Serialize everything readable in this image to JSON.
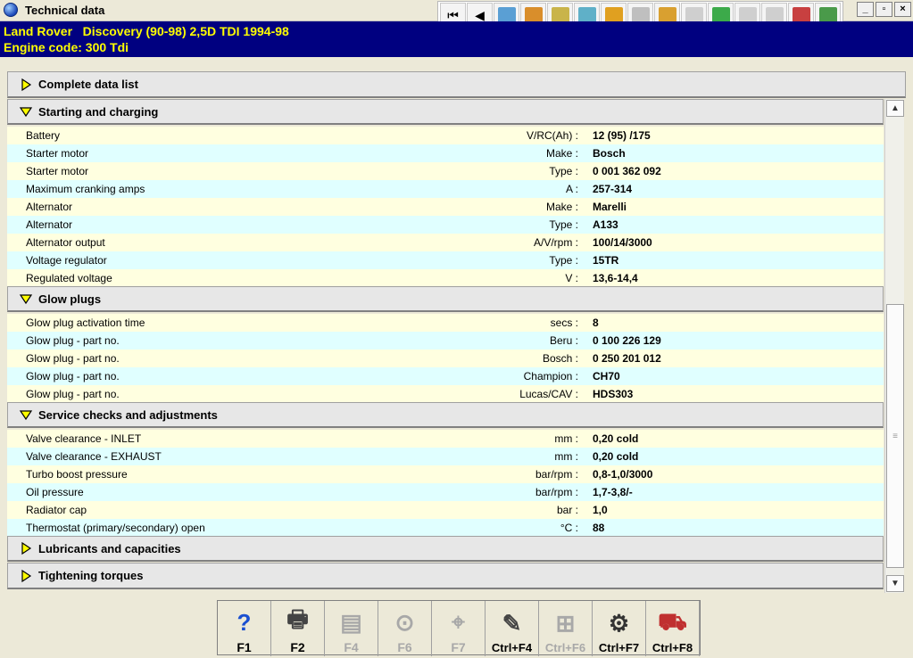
{
  "window": {
    "title": "Technical data",
    "controls": [
      "_",
      "▫",
      "×"
    ]
  },
  "toolbar": {
    "buttons": [
      {
        "name": "first-record-button",
        "glyph": "⏮",
        "color": ""
      },
      {
        "name": "previous-button",
        "glyph": "◀",
        "color": ""
      },
      {
        "name": "map-icon",
        "glyph": "",
        "color": "#5a9fd4"
      },
      {
        "name": "engine-icon",
        "glyph": "",
        "color": "#d98e2b"
      },
      {
        "name": "tools-icon",
        "glyph": "",
        "color": "#c9b44a"
      },
      {
        "name": "diagnostics-icon",
        "glyph": "",
        "color": "#5fb0c8"
      },
      {
        "name": "oil-icon",
        "glyph": "",
        "color": "#e0a020"
      },
      {
        "name": "lift-icon",
        "glyph": "",
        "color": "#bfbfbf"
      },
      {
        "name": "parts-icon",
        "glyph": "",
        "color": "#d9a030"
      },
      {
        "name": "wiring-icon",
        "glyph": "",
        "color": "#cfcfcf"
      },
      {
        "name": "battery-icon",
        "glyph": "",
        "color": "#3caa4a"
      },
      {
        "name": "brake-icon",
        "glyph": "",
        "color": "#cfcfcf"
      },
      {
        "name": "wheel-icon",
        "glyph": "",
        "color": "#cfcfcf"
      },
      {
        "name": "car-service-icon",
        "glyph": "",
        "color": "#c84040"
      },
      {
        "name": "extra-icon",
        "glyph": "",
        "color": "#4a9a4a"
      }
    ]
  },
  "vehicle": {
    "line1": "Land Rover   Discovery (90-98) 2,5D TDI 1994-98",
    "line2": "Engine code: 300 Tdi"
  },
  "sections": {
    "complete": {
      "title": "Complete data list"
    },
    "starting": {
      "title": "Starting and charging",
      "rows": [
        {
          "label": "Battery",
          "unit": "V/RC(Ah) :",
          "value": "12 (95) /175"
        },
        {
          "label": "Starter motor",
          "unit": "Make :",
          "value": "Bosch"
        },
        {
          "label": "Starter motor",
          "unit": "Type :",
          "value": "0 001 362 092"
        },
        {
          "label": "Maximum cranking amps",
          "unit": "A :",
          "value": "257-314"
        },
        {
          "label": "Alternator",
          "unit": "Make :",
          "value": "Marelli"
        },
        {
          "label": "Alternator",
          "unit": "Type :",
          "value": "A133"
        },
        {
          "label": "Alternator output",
          "unit": "A/V/rpm :",
          "value": "100/14/3000"
        },
        {
          "label": "Voltage regulator",
          "unit": "Type :",
          "value": "15TR"
        },
        {
          "label": "Regulated voltage",
          "unit": "V :",
          "value": "13,6-14,4"
        }
      ]
    },
    "glow": {
      "title": "Glow plugs",
      "rows": [
        {
          "label": "Glow plug activation time",
          "unit": "secs :",
          "value": "8"
        },
        {
          "label": "Glow plug - part no.",
          "unit": "Beru :",
          "value": "0 100 226 129"
        },
        {
          "label": "Glow plug - part no.",
          "unit": "Bosch :",
          "value": "0 250 201 012"
        },
        {
          "label": "Glow plug - part no.",
          "unit": "Champion :",
          "value": "CH70"
        },
        {
          "label": "Glow plug - part no.",
          "unit": "Lucas/CAV :",
          "value": "HDS303"
        }
      ]
    },
    "service": {
      "title": "Service checks and adjustments",
      "rows": [
        {
          "label": "Valve clearance - INLET",
          "unit": "mm :",
          "value": "0,20  cold"
        },
        {
          "label": "Valve clearance - EXHAUST",
          "unit": "mm :",
          "value": "0,20  cold"
        },
        {
          "label": "Turbo boost pressure",
          "unit": "bar/rpm :",
          "value": "0,8-1,0/3000"
        },
        {
          "label": "Oil pressure",
          "unit": "bar/rpm :",
          "value": "1,7-3,8/-"
        },
        {
          "label": "Radiator cap",
          "unit": "bar :",
          "value": "1,0"
        },
        {
          "label": "Thermostat (primary/secondary) open",
          "unit": "°C :",
          "value": "88"
        }
      ]
    },
    "lubricants": {
      "title": "Lubricants and capacities"
    },
    "torques": {
      "title": "Tightening torques"
    }
  },
  "scrollbar": {
    "up": "▲",
    "down": "▼",
    "grip": "≡"
  },
  "fkeys": [
    {
      "name": "f1-help-button",
      "label": "F1",
      "glyph": "?",
      "color": "#1a4fd0",
      "disabled": false
    },
    {
      "name": "f2-print-button",
      "label": "F2",
      "glyph": "🖶",
      "color": "#444444",
      "disabled": false
    },
    {
      "name": "f4-button",
      "label": "F4",
      "glyph": "▤",
      "color": "#a8a8a8",
      "disabled": true
    },
    {
      "name": "f6-button",
      "label": "F6",
      "glyph": "⊙",
      "color": "#a8a8a8",
      "disabled": true
    },
    {
      "name": "f7-button",
      "label": "F7",
      "glyph": "⌖",
      "color": "#a8a8a8",
      "disabled": true
    },
    {
      "name": "ctrl-f4-button",
      "label": "Ctrl+F4",
      "glyph": "✎",
      "color": "#444444",
      "disabled": false
    },
    {
      "name": "ctrl-f6-button",
      "label": "Ctrl+F6",
      "glyph": "⊞",
      "color": "#a8a8a8",
      "disabled": true
    },
    {
      "name": "ctrl-f7-button",
      "label": "Ctrl+F7",
      "glyph": "⚙",
      "color": "#333333",
      "disabled": false
    },
    {
      "name": "ctrl-f8-button",
      "label": "Ctrl+F8",
      "glyph": "⛟",
      "color": "#c03030",
      "disabled": false
    }
  ]
}
